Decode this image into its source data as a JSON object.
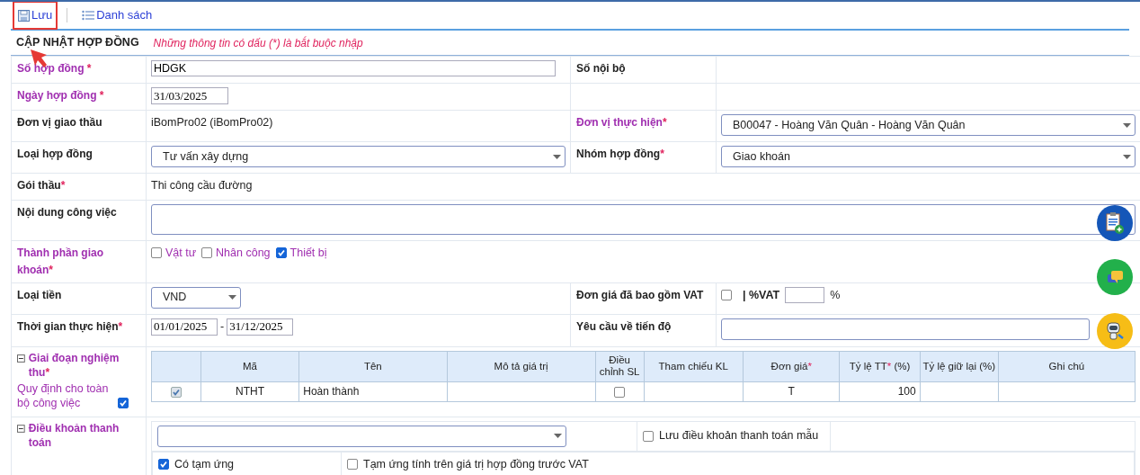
{
  "toolbar": [
    {
      "label": "Lưu",
      "kind": "save",
      "highlighted": true
    },
    {
      "label": "Danh sách",
      "kind": "list",
      "highlighted": false
    }
  ],
  "pointer_arrow": true,
  "form": {
    "title": "CẬP NHẬT HỢP ĐỒNG",
    "note": "Những thông tin có dấu (*) là bắt buộc nhập",
    "rows": [
      {
        "cells": [
          {
            "label": "Số hợp đồng",
            "mark": " *",
            "emphasis": true,
            "kind": "input",
            "value": "HDGK"
          },
          {
            "label": "Số nội bộ",
            "emphasis": false
          }
        ]
      },
      {
        "cells": [
          {
            "label": "Ngày hợp đồng",
            "mark": " *",
            "emphasis": true,
            "kind": "date",
            "value": "31/03/2025"
          }
        ]
      },
      {
        "cells": [
          {
            "label": "Đơn vị giao thầu",
            "emphasis": false,
            "kind": "text",
            "value": "iBomPro02 (iBomPro02)"
          },
          {
            "label": "Đơn vị thực hiện",
            "mark": "*",
            "emphasis": true,
            "kind": "select",
            "value": "B00047 - Hoàng Văn Quân - Hoàng Văn Quân"
          }
        ]
      },
      {
        "cells": [
          {
            "label": "Loại hợp đồng",
            "emphasis": false,
            "kind": "select",
            "value": "Tư vấn xây dựng"
          },
          {
            "label": "Nhóm hợp đồng",
            "mark": "*",
            "emphasis": false,
            "kind": "select",
            "value": "Giao khoán"
          }
        ]
      },
      {
        "cells": [
          {
            "label": "Gói thầu",
            "mark": "*",
            "emphasis": false,
            "kind": "text",
            "wide": true,
            "value": "Thi công cầu đường"
          }
        ]
      },
      {
        "cells": [
          {
            "label": "Nội dung công việc",
            "emphasis": false,
            "kind": "textarea",
            "wide": true
          }
        ]
      },
      {
        "cells": [
          {
            "label": "Thành phần giao khoán",
            "mark": "*",
            "emphasis": true,
            "kind": "checks",
            "wide": true,
            "options": [
              {
                "label": "Vật tư",
                "checked": false
              },
              {
                "label": "Nhân công",
                "checked": false
              },
              {
                "label": "Thiết bị",
                "checked": true
              }
            ]
          }
        ]
      },
      {
        "cells": [
          {
            "label": "Loại tiền",
            "emphasis": false,
            "kind": "small-select",
            "value": "VND"
          },
          {
            "label": "Đơn giá đã bao gồm VAT",
            "emphasis": false,
            "kind": "vat",
            "checked": false,
            "separator": "| %VAT",
            "unit": "%"
          }
        ]
      },
      {
        "cells": [
          {
            "label": "Thời gian thực hiện",
            "mark": "*",
            "emphasis": false,
            "kind": "daterange",
            "from": "01/01/2025",
            "dash": "-",
            "to": "31/12/2025"
          },
          {
            "label": "Yêu cầu về tiến độ",
            "emphasis": false,
            "kind": "input"
          }
        ]
      },
      {
        "cells": [
          {
            "label": "Giai đoạn nghiệm thu",
            "mark": "*",
            "emphasis": true,
            "kind": "stages",
            "wide": true,
            "expanded": true,
            "note": {
              "text": "Quy định cho toàn bộ công việc",
              "checked": true
            },
            "columns": [
              {
                "text": "Mã"
              },
              {
                "text": "Tên"
              },
              {
                "text": "Mô tả giá trị"
              },
              {
                "text": "Điều chỉnh SL"
              },
              {
                "text": "Tham chiếu KL"
              },
              {
                "text": "Đơn giá",
                "mark": "*"
              },
              {
                "text": "Tỷ lệ TT",
                "mark": "*",
                "after": " (%)"
              },
              {
                "text": "Tỷ lệ giữ lại (%)"
              },
              {
                "text": "Ghi chú"
              }
            ],
            "rows": [
              {
                "checked": true,
                "code": "NTHT",
                "name": "Hoàn thành",
                "adjust_qty": false,
                "unit_price": "T",
                "pay_rate": "100"
              }
            ]
          }
        ]
      },
      {
        "cells": [
          {
            "label": "Điều khoản thanh toán",
            "emphasis": true,
            "kind": "payment",
            "wide": true,
            "expanded": true,
            "save_template": {
              "label": "Lưu điều khoản thanh toán mẫu",
              "checked": false
            },
            "options": [
              {
                "label": "Có tạm ứng",
                "checked": true
              },
              {
                "label": "Tạm ứng tính trên giá trị hợp đồng trước VAT",
                "checked": false
              }
            ]
          }
        ]
      }
    ]
  },
  "floating_buttons": [
    {
      "kind": "note"
    },
    {
      "kind": "chat"
    },
    {
      "kind": "assistant"
    }
  ]
}
